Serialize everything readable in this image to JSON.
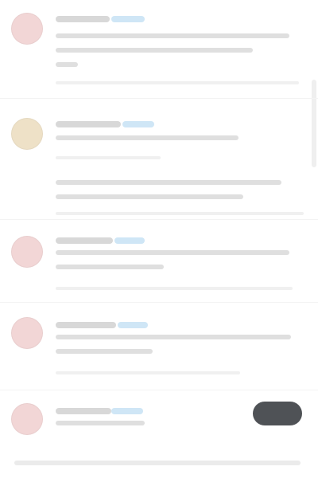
{
  "colors": {
    "background": "#ffffff",
    "avatar_pink": "#f2d6d6",
    "avatar_beige": "#eee1c7",
    "placeholder_gray": "#dfdfdf",
    "verified_blue": "#cfe6f6",
    "button_dark": "#4f5256"
  },
  "feed": {
    "items": [
      {
        "avatar_icon": "avatar-icon"
      },
      {
        "avatar_icon": "avatar-icon"
      },
      {
        "avatar_icon": "avatar-icon"
      },
      {
        "avatar_icon": "avatar-icon"
      },
      {
        "avatar_icon": "avatar-icon"
      }
    ]
  },
  "actions": {
    "follow_button_label": ""
  }
}
